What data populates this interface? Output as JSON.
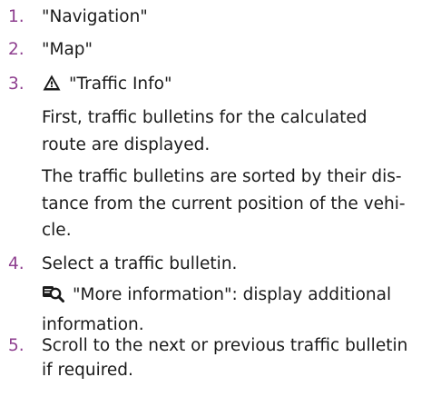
{
  "steps": [
    {
      "number": "1.",
      "text": "\"Navigation\""
    },
    {
      "number": "2.",
      "text": "\"Map\""
    },
    {
      "number": "3.",
      "icon": "traffic-warning-icon",
      "text": "\"Traffic Info\"",
      "notes": [
        {
          "lines": [
            "First, traffic bulletins for the calculated",
            "route are displayed."
          ]
        },
        {
          "lines": [
            "The traffic bulletins are sorted by their dis-",
            "tance from the current position of the vehi-",
            "cle."
          ]
        }
      ]
    },
    {
      "number": "4.",
      "text": "Select a traffic bulletin.",
      "notes": [
        {
          "icon": "magnifier-info-icon",
          "lines": [
            "\"More information\": display additional",
            "information."
          ]
        }
      ]
    },
    {
      "number": "5.",
      "lines": [
        "Scroll to the next or previous traffic bulletin",
        "if required."
      ]
    }
  ],
  "colors": {
    "step_number": "#8e3f8f",
    "text": "#1a1a1a"
  }
}
